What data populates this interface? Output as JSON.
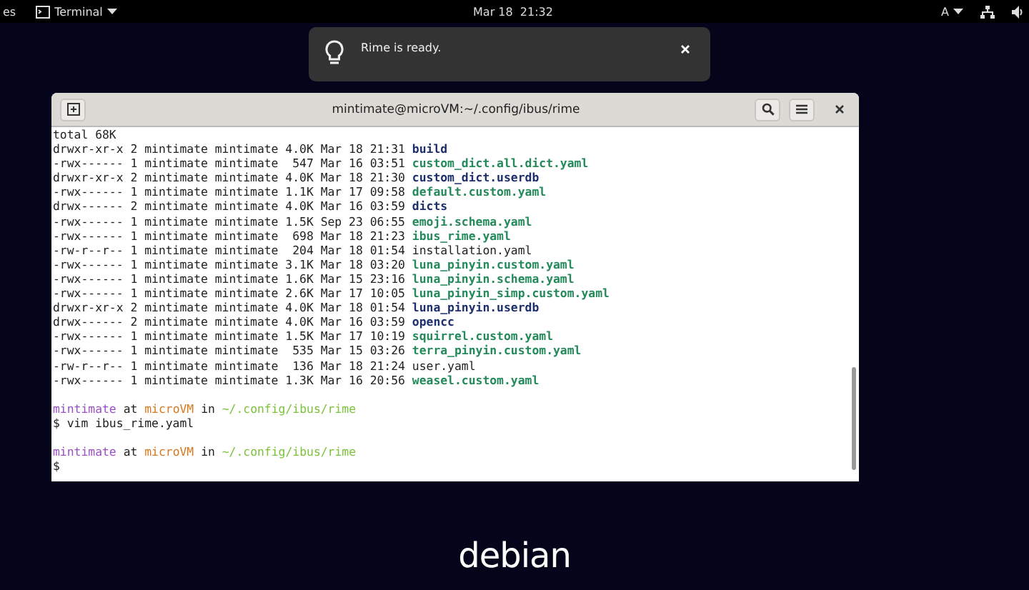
{
  "top_bar": {
    "activities": "es",
    "app_menu": "Terminal",
    "clock": "Mar 18  21:32",
    "input_method": "A"
  },
  "notification": {
    "message": "Rime is ready."
  },
  "terminal": {
    "title": "mintimate@microVM:~/.config/ibus/rime",
    "total": "total 68K",
    "rows": [
      {
        "meta": "drwxr-xr-x 2 mintimate mintimate 4.0K Mar 18 21:31",
        "name": "build",
        "kind": "dir"
      },
      {
        "meta": "-rwx------ 1 mintimate mintimate  547 Mar 16 03:51",
        "name": "custom_dict.all.dict.yaml",
        "kind": "exec"
      },
      {
        "meta": "drwxr-xr-x 2 mintimate mintimate 4.0K Mar 18 21:30",
        "name": "custom_dict.userdb",
        "kind": "dir"
      },
      {
        "meta": "-rwx------ 1 mintimate mintimate 1.1K Mar 17 09:58",
        "name": "default.custom.yaml",
        "kind": "exec"
      },
      {
        "meta": "drwx------ 2 mintimate mintimate 4.0K Mar 16 03:59",
        "name": "dicts",
        "kind": "dir"
      },
      {
        "meta": "-rwx------ 1 mintimate mintimate 1.5K Sep 23 06:55",
        "name": "emoji.schema.yaml",
        "kind": "exec"
      },
      {
        "meta": "-rwx------ 1 mintimate mintimate  698 Mar 18 21:23",
        "name": "ibus_rime.yaml",
        "kind": "exec"
      },
      {
        "meta": "-rw-r--r-- 1 mintimate mintimate  204 Mar 18 01:54",
        "name": "installation.yaml",
        "kind": "file"
      },
      {
        "meta": "-rwx------ 1 mintimate mintimate 3.1K Mar 18 03:20",
        "name": "luna_pinyin.custom.yaml",
        "kind": "exec"
      },
      {
        "meta": "-rwx------ 1 mintimate mintimate 1.6K Mar 15 23:16",
        "name": "luna_pinyin.schema.yaml",
        "kind": "exec"
      },
      {
        "meta": "-rwx------ 1 mintimate mintimate 2.6K Mar 17 10:05",
        "name": "luna_pinyin_simp.custom.yaml",
        "kind": "exec"
      },
      {
        "meta": "drwxr-xr-x 2 mintimate mintimate 4.0K Mar 18 01:54",
        "name": "luna_pinyin.userdb",
        "kind": "dir"
      },
      {
        "meta": "drwx------ 2 mintimate mintimate 4.0K Mar 16 03:59",
        "name": "opencc",
        "kind": "dir"
      },
      {
        "meta": "-rwx------ 1 mintimate mintimate 1.5K Mar 17 10:19",
        "name": "squirrel.custom.yaml",
        "kind": "exec"
      },
      {
        "meta": "-rwx------ 1 mintimate mintimate  535 Mar 15 03:26",
        "name": "terra_pinyin.custom.yaml",
        "kind": "exec"
      },
      {
        "meta": "-rw-r--r-- 1 mintimate mintimate  136 Mar 18 21:24",
        "name": "user.yaml",
        "kind": "file"
      },
      {
        "meta": "-rwx------ 1 mintimate mintimate 1.3K Mar 16 20:56",
        "name": "weasel.custom.yaml",
        "kind": "exec"
      }
    ],
    "session": [
      {
        "kind": "prompt",
        "user": "mintimate",
        "at": "at",
        "host": "microVM",
        "in": "in",
        "path": "~/.config/ibus/rime"
      },
      {
        "kind": "command",
        "text": "$ vim ibus_rime.yaml"
      },
      {
        "kind": "blank"
      },
      {
        "kind": "prompt",
        "user": "mintimate",
        "at": "at",
        "host": "microVM",
        "in": "in",
        "path": "~/.config/ibus/rime"
      },
      {
        "kind": "command",
        "text": "$"
      }
    ]
  },
  "wallpaper": {
    "logo": "debian"
  }
}
